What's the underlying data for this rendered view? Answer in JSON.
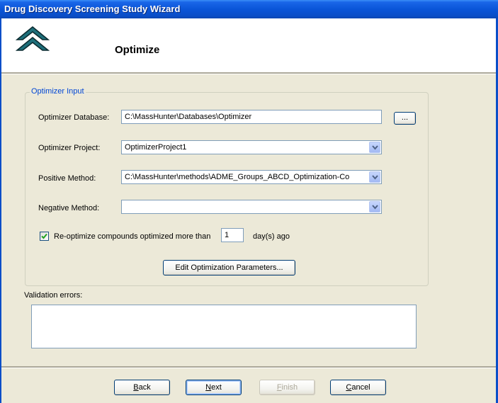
{
  "window": {
    "title": "Drug Discovery Screening Study Wizard"
  },
  "header": {
    "page_title": "Optimize",
    "logo_icon": "double-chevron-up-logo-icon"
  },
  "optimizer_input": {
    "group_label": "Optimizer Input",
    "database": {
      "label": "Optimizer Database:",
      "value": "C:\\MassHunter\\Databases\\Optimizer",
      "browse_label": "..."
    },
    "project": {
      "label": "Optimizer Project:",
      "value": "OptimizerProject1"
    },
    "positive_method": {
      "label": "Positive Method:",
      "value": "C:\\MassHunter\\methods\\ADME_Groups_ABCD_Optimization-Co"
    },
    "negative_method": {
      "label": "Negative Method:",
      "value": ""
    },
    "reoptimize": {
      "checked": true,
      "label": "Re-optimize compounds optimized more than",
      "days_value": "1",
      "suffix": "day(s) ago"
    },
    "edit_params_label": "Edit Optimization Parameters..."
  },
  "validation": {
    "label": "Validation errors:",
    "text": ""
  },
  "buttons": {
    "back": {
      "mnemonic": "B",
      "rest": "ack"
    },
    "next": {
      "mnemonic": "N",
      "rest": "ext"
    },
    "finish": {
      "mnemonic": "F",
      "rest": "inish",
      "disabled": true
    },
    "cancel": {
      "mnemonic": "C",
      "rest": "ancel"
    }
  },
  "colors": {
    "title_bar": "#0a55d8",
    "dialog_bg": "#ece9d8",
    "group_label": "#0046d5",
    "logo_teal": "#1e6f7a"
  }
}
